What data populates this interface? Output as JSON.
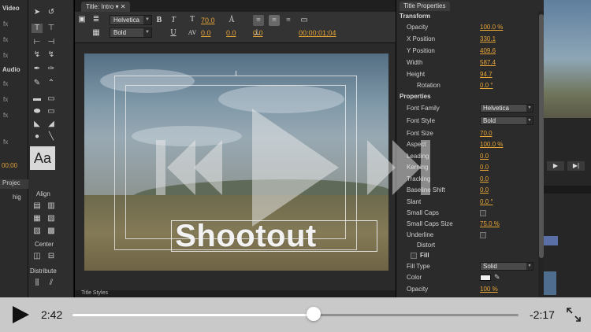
{
  "left_panel": {
    "video_label": "Video",
    "audio_label": "Audio",
    "timecode": "00;00",
    "project_tab": "Projec",
    "project_item": "hig",
    "fx_label": "fx"
  },
  "tools": {
    "preview_text": "Aa",
    "align_label": "Align",
    "center_label": "Center",
    "distribute_label": "Distribute"
  },
  "designer": {
    "tab_label": "Title: Intro",
    "font_family": "Helvetica",
    "font_style": "Bold",
    "font_size": "70.0",
    "kerning": "0.0",
    "tracking": "0.0",
    "leading": "0.0",
    "timecode": "00;00;01;04",
    "canvas_text": "Shootout",
    "bottom_tab": "Title Styles"
  },
  "properties": {
    "tab_label": "Title Properties",
    "transform_header": "Transform",
    "properties_header": "Properties",
    "fill_header": "Fill",
    "rows": {
      "opacity": {
        "label": "Opacity",
        "value": "100.0 %"
      },
      "x_position": {
        "label": "X Position",
        "value": "330.1"
      },
      "y_position": {
        "label": "Y Position",
        "value": "409.6"
      },
      "width": {
        "label": "Width",
        "value": "587.4"
      },
      "height": {
        "label": "Height",
        "value": "94.7"
      },
      "rotation": {
        "label": "Rotation",
        "value": "0.0 °"
      },
      "font_family": {
        "label": "Font Family",
        "value": "Helvetica"
      },
      "font_style": {
        "label": "Font Style",
        "value": "Bold"
      },
      "font_size": {
        "label": "Font Size",
        "value": "70.0"
      },
      "aspect": {
        "label": "Aspect",
        "value": "100.0 %"
      },
      "leading": {
        "label": "Leading",
        "value": "0.0"
      },
      "kerning": {
        "label": "Kerning",
        "value": "0.0"
      },
      "tracking": {
        "label": "Tracking",
        "value": "0.0"
      },
      "baseline_shift": {
        "label": "Baseline Shift",
        "value": "0.0"
      },
      "slant": {
        "label": "Slant",
        "value": "0.0 °"
      },
      "small_caps": {
        "label": "Small Caps"
      },
      "small_caps_size": {
        "label": "Small Caps Size",
        "value": "75.0 %"
      },
      "underline": {
        "label": "Underline"
      },
      "distort": {
        "label": "Distort"
      },
      "fill_type": {
        "label": "Fill Type",
        "value": "Solid"
      },
      "color": {
        "label": "Color"
      },
      "fill_opacity": {
        "label": "Opacity",
        "value": "100 %"
      }
    }
  },
  "player": {
    "elapsed": "2:42",
    "remaining": "-2:17",
    "progress": 0.54
  },
  "colors": {
    "accent_value": "#e8a637",
    "player_bar": "#c9c9c9"
  }
}
